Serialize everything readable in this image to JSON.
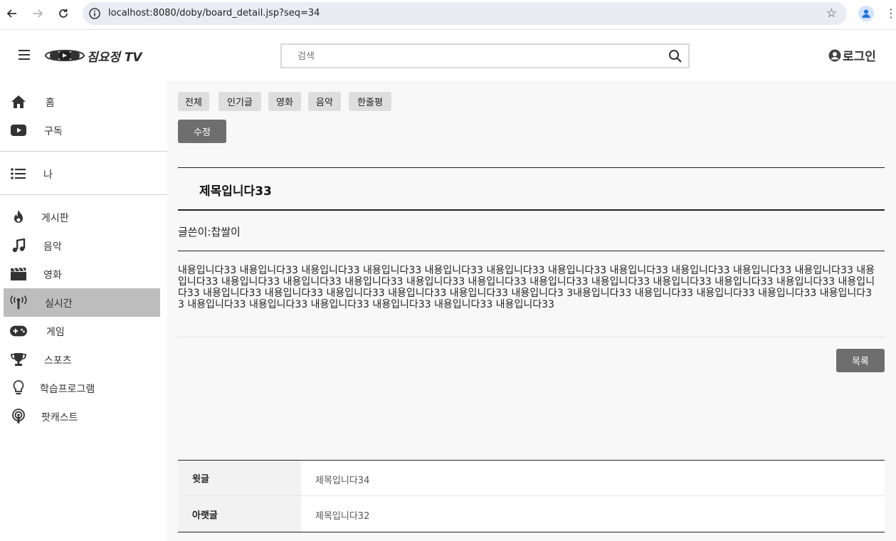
{
  "browser": {
    "url": "localhost:8080/doby/board_detail.jsp?seq=34",
    "back_icon": "arrow-left",
    "forward_icon": "arrow-right",
    "reload_icon": "reload",
    "site_info_icon": "info-circle",
    "bookmark_icon": "star",
    "profile_icon": "person",
    "menu_icon": "kebab"
  },
  "header": {
    "logo_text": "짐요정 TV",
    "search_placeholder": "검색",
    "login_label": "로그인"
  },
  "sidebar": {
    "items": [
      {
        "label": "홈",
        "icon": "home"
      },
      {
        "label": "구독",
        "icon": "youtube-play"
      },
      {
        "label": "나",
        "icon": "list"
      },
      {
        "label": "게시판",
        "icon": "fire"
      },
      {
        "label": "음악",
        "icon": "music-note"
      },
      {
        "label": "영화",
        "icon": "clapperboard"
      },
      {
        "label": "실시간",
        "icon": "broadcast",
        "active": true
      },
      {
        "label": "게임",
        "icon": "gamepad"
      },
      {
        "label": "스포츠",
        "icon": "trophy"
      },
      {
        "label": "학습프로그램",
        "icon": "lightbulb"
      },
      {
        "label": "팟캐스트",
        "icon": "podcast"
      }
    ]
  },
  "categories": [
    "전체",
    "인기글",
    "영화",
    "음악",
    "한줄평"
  ],
  "edit_button": "수정",
  "post": {
    "title": "제목입니다33",
    "author": "글쓴이:찹쌀이",
    "content": "내용입니다33 내용입니다33 내용입니다33 내용입니다33 내용입니다33 내용입니다33 내용입니다33 내용입니다33 내용입니다33 내용입니다33 내용입니다33 내용입니다33 내용입니다33 내용입니다33 내용입니다33 내용입니다33 내용입니다33 내용입니다33 내용입니다33 내용입니다33 내용입니다33 내용입니다33 내용입니다33 내용입니다33 내용입니다33 내용입니다33 내용입니다33 내용입니다33 내용입니다3 3내용입니다33 내용입니다33 내용입니다33 내용입니다33 내용입니다33 내용입니다33 내용입니다33 내용입니다33 내용입니다33 내용입니다33 내용입니다33"
  },
  "list_button": "목록",
  "nav": {
    "prev_label": "윗글",
    "prev_title": "제목입니다34",
    "next_label": "아랫글",
    "next_title": "제목입니다32"
  },
  "colors": {
    "active_sidebar": "#bdbdbd",
    "button_gray": "#6e6e6e",
    "chip_gray": "#dedede",
    "main_bg": "#f8f8f8"
  }
}
